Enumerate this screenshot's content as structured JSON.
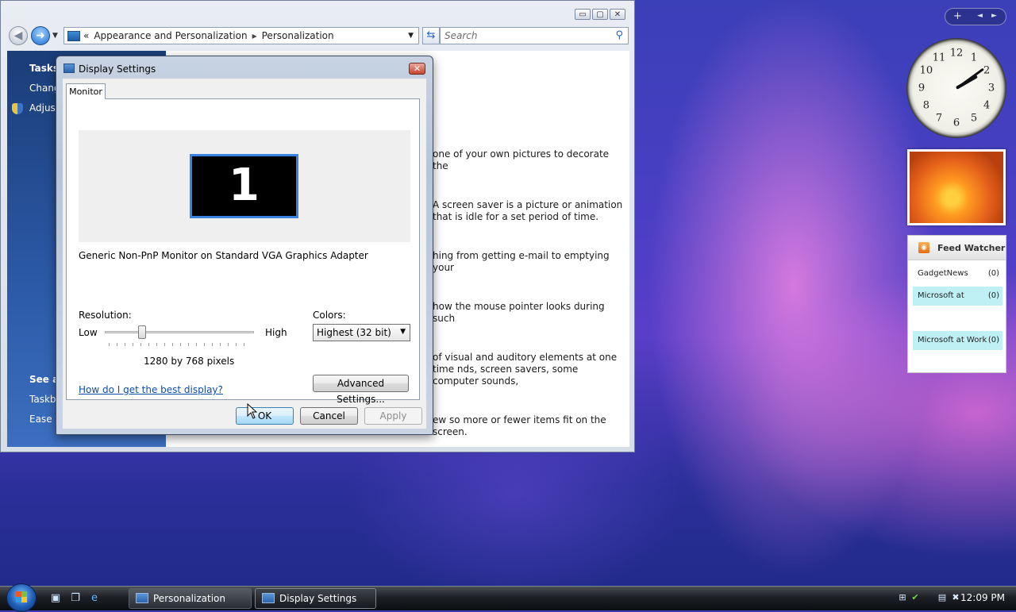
{
  "explorer": {
    "breadcrumb": [
      "Appearance and Personalization",
      "Personalization"
    ],
    "breadcrumb_prefix": "«",
    "search_placeholder": "Search",
    "controls": {
      "minimize": "▭",
      "maximize": "▢",
      "close": "✕"
    },
    "left_pane": {
      "tasks_title": "Tasks",
      "task_items": [
        "Chang",
        "Adjust"
      ],
      "see_also_title": "See al",
      "see_also_items": [
        "Taskba",
        "Ease o"
      ]
    },
    "content_snippets": [
      "one of your own pictures to decorate the",
      "A screen saver is a picture or animation that is idle for a set period of time.",
      "hing from getting e-mail to emptying your",
      "how the mouse pointer looks during such",
      "of visual and auditory elements at one time nds, screen savers, some computer sounds,",
      "ew so more or fewer items fit on the screen."
    ]
  },
  "dialog": {
    "title": "Display Settings",
    "tab": "Monitor",
    "monitor_number": "1",
    "adapter": "Generic Non-PnP Monitor on Standard VGA Graphics Adapter",
    "resolution_label": "Resolution:",
    "low_label": "Low",
    "high_label": "High",
    "resolution_level": 0.25,
    "resolution_value": "1280 by 768 pixels",
    "colors_label": "Colors:",
    "colors_value": "Highest (32 bit)",
    "help_link": "How do I get the best display?",
    "advanced_button": "Advanced Settings...",
    "ok_button": "OK",
    "cancel_button": "Cancel",
    "apply_button": "Apply"
  },
  "gadgets": {
    "sidebar_add": "+",
    "sidebar_prev": "◄",
    "sidebar_next": "►",
    "clock_numbers": [
      "12",
      "1",
      "2",
      "3",
      "4",
      "5",
      "6",
      "7",
      "8",
      "9",
      "10",
      "11"
    ],
    "feed_title": "Feed Watcher",
    "feeds": [
      {
        "name": "GadgetNews",
        "count": "(0)"
      },
      {
        "name": "Microsoft at",
        "count": "(0)"
      },
      {
        "name": "",
        "count": ""
      },
      {
        "name": "Microsoft at Work",
        "count": "(0)"
      }
    ]
  },
  "taskbar": {
    "tasks": [
      "Personalization",
      "Display Settings"
    ],
    "time": "12:09 PM"
  },
  "colors": {
    "accent": "#3b83e0",
    "link": "#0f4da8"
  }
}
